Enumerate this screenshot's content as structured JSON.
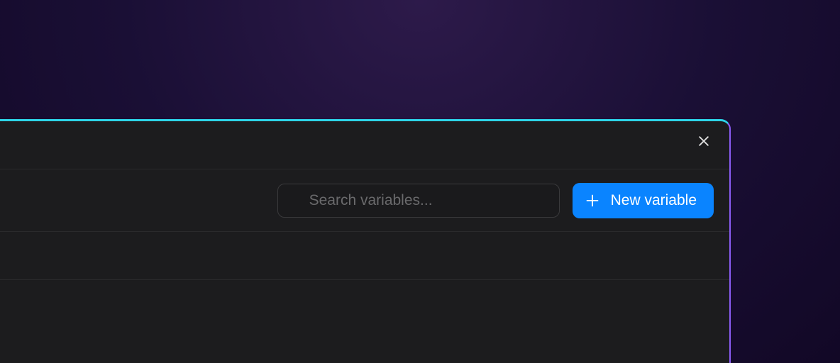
{
  "toolbar": {
    "search": {
      "placeholder": "Search variables..."
    },
    "new_button": {
      "label": "New variable"
    }
  }
}
